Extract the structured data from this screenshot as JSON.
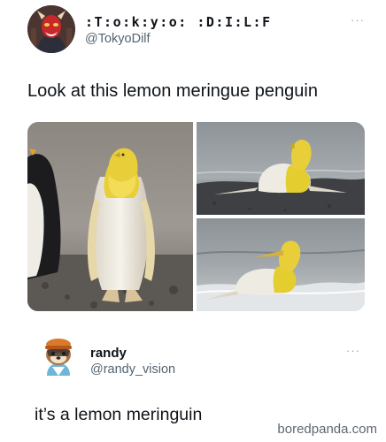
{
  "posts": [
    {
      "display_name": ":T:o:k:y:o: :D:I:L:F",
      "handle": "@TokyoDilf",
      "more_label": "···",
      "text": "Look at this lemon meringue penguin",
      "avatar_icon": "devil-mask-avatar-icon"
    },
    {
      "display_name": "randy",
      "handle": "@randy_vision",
      "more_label": "···",
      "text": "it’s a lemon meringuin",
      "avatar_icon": "raccoon-villager-avatar-icon"
    }
  ],
  "watermark": "boredpanda.com",
  "colors": {
    "text_primary": "#0f1419",
    "text_secondary": "#536471",
    "penguin_yellow": "#e8cf3a",
    "penguin_white": "#f1efe9"
  }
}
